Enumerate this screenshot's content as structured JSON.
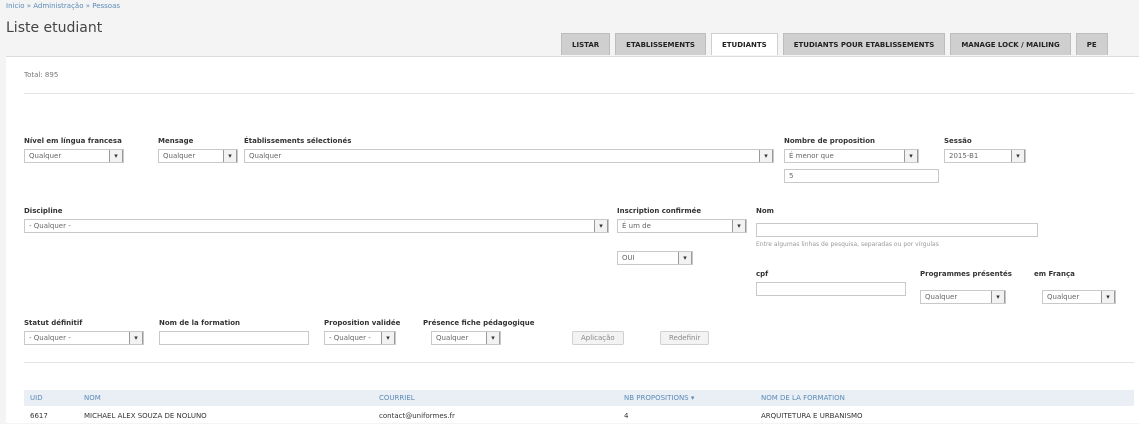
{
  "breadcrumb": "Inicio » Administração » Pessoas",
  "page_title": "Liste etudiant",
  "tabs": [
    {
      "label": "LISTAR"
    },
    {
      "label": "ETABLISSEMENTS"
    },
    {
      "label": "ETUDIANTS"
    },
    {
      "label": "ETUDIANTS POUR ETABLISSEMENTS"
    },
    {
      "label": "MANAGE LOCK / MAILING"
    },
    {
      "label": "PE"
    }
  ],
  "total": "Total: 895",
  "filters": {
    "nivel": {
      "label": "Nível em língua francesa",
      "value": "Qualquer"
    },
    "mensage": {
      "label": "Mensage",
      "value": "Qualquer"
    },
    "etablissements": {
      "label": "Établissements sélectionés",
      "value": "Qualquer"
    },
    "nombre": {
      "label": "Nombre de proposition",
      "value": "É menor que",
      "amount": "5"
    },
    "session": {
      "label": "Sessão",
      "value": "2015-B1"
    },
    "discipline": {
      "label": "Discipline",
      "value": "- Qualquer -"
    },
    "inscription": {
      "label": "Inscription confirmée",
      "value": "É um de",
      "sub_value": "OUI"
    },
    "nom": {
      "label": "Nom",
      "value": "",
      "hint": "Entre algumas linhas de pesquisa, separadas ou por vírgulas"
    },
    "cpf": {
      "label": "cpf",
      "value": ""
    },
    "programmes": {
      "label": "Programmes présentés",
      "value": "Qualquer"
    },
    "en_france": {
      "label": "em França",
      "value": "Qualquer"
    },
    "statut": {
      "label": "Statut définitif",
      "value": "- Qualquer -"
    },
    "nom_formation": {
      "label": "Nom de la formation",
      "value": ""
    },
    "proposition": {
      "label": "Proposition validée",
      "value": "- Qualquer -"
    },
    "presence": {
      "label": "Présence fiche pédagogique",
      "value": "Qualquer"
    }
  },
  "buttons": {
    "apply": "Aplicação",
    "reset": "Redefinir"
  },
  "table": {
    "headers": [
      "UID",
      "NOM",
      "COURRIEL",
      "NB PROPOSITIONS ▾",
      "NOM DE LA FORMATION"
    ],
    "rows": [
      [
        "6617",
        "MICHAEL ALEX SOUZA DE NOLUNO",
        "contact@uniformes.fr",
        "4",
        "ARQUITETURA E URBANISMO"
      ]
    ]
  }
}
